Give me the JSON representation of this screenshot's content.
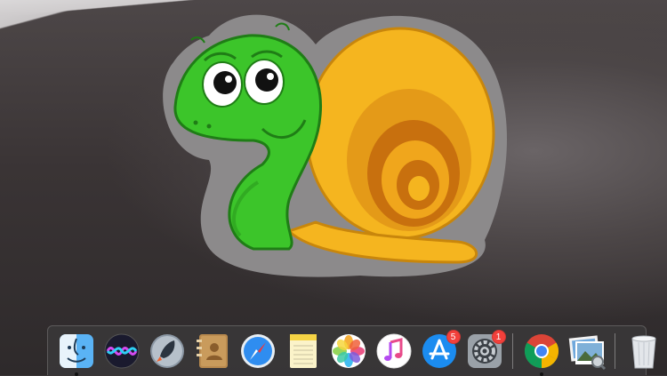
{
  "desktop": {
    "wallpaper": "dark-mojave-dunes",
    "sticker": "cartoon-snail"
  },
  "dock": {
    "items": [
      {
        "name": "finder",
        "icon": "finder-icon",
        "running": true
      },
      {
        "name": "siri",
        "icon": "siri-icon",
        "running": false
      },
      {
        "name": "launchpad",
        "icon": "rocket-icon",
        "running": false
      },
      {
        "name": "contacts",
        "icon": "contacts-book-icon",
        "running": false
      },
      {
        "name": "safari",
        "icon": "compass-icon",
        "running": false
      },
      {
        "name": "notes",
        "icon": "notepad-icon",
        "running": false
      },
      {
        "name": "photos",
        "icon": "photos-flower-icon",
        "running": false
      },
      {
        "name": "itunes",
        "icon": "music-note-icon",
        "running": false
      },
      {
        "name": "app-store",
        "icon": "app-store-icon",
        "running": false,
        "badge": "5"
      },
      {
        "name": "system-preferences",
        "icon": "gear-icon",
        "running": false,
        "badge": "1"
      },
      {
        "name": "chrome",
        "icon": "chrome-icon",
        "running": true
      },
      {
        "name": "preview",
        "icon": "preview-photos-icon",
        "running": false
      },
      {
        "name": "trash",
        "icon": "trash-icon",
        "running": false
      }
    ]
  },
  "colors": {
    "badge": "#f2403b",
    "snail_body": "#3cc52a",
    "snail_shell": "#f5b51f"
  }
}
